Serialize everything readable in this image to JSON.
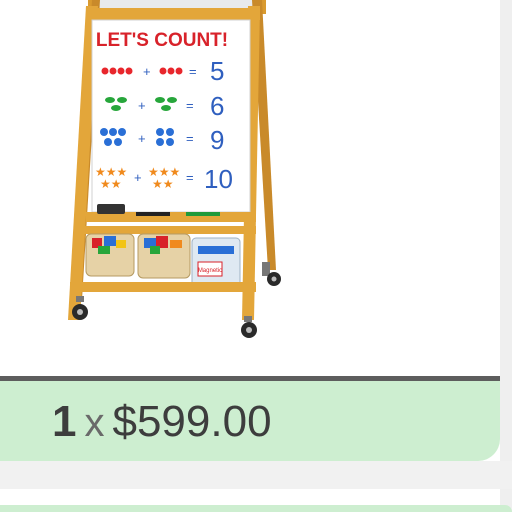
{
  "product_image": {
    "board_heading": "LET'S COUNT!",
    "equations": [
      {
        "left": "●●●",
        "right": "●●",
        "answer": "5",
        "color": "#e8262c"
      },
      {
        "left": "●●",
        "right": "●●",
        "answer": "6",
        "color": "#27a63b"
      },
      {
        "left": "●●",
        "right": "●●",
        "answer": "9",
        "color": "#2a6fd6"
      },
      {
        "left": "★★★",
        "right": "★★★",
        "answer": "10",
        "color": "#f08a1d"
      }
    ],
    "basket_label": "Magnetic"
  },
  "price": {
    "quantity": "1",
    "times": "x",
    "amount": "$599.00"
  },
  "colors": {
    "price_bar": "#cdeed0",
    "divider": "#5d5d5d",
    "wood": "#e3a63a",
    "board_heading": "#d8222a",
    "numbers": "#2f5fbf"
  }
}
